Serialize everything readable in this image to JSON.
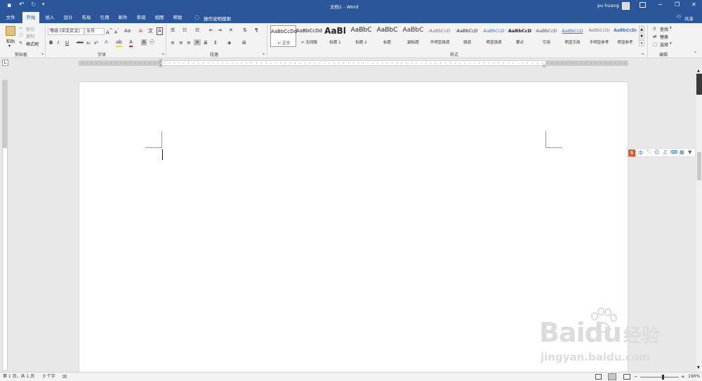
{
  "titlebar": {
    "title": "文档1 - Word",
    "user": "pu huang"
  },
  "tabs": [
    "文件",
    "开始",
    "插入",
    "设计",
    "布局",
    "引用",
    "邮件",
    "审阅",
    "视图",
    "帮助"
  ],
  "tell_me": "操作说明搜索",
  "share": "共享",
  "clipboard": {
    "paste": "粘贴",
    "cut": "剪切",
    "copy": "复制",
    "format_painter": "格式刷",
    "label": "剪贴板"
  },
  "font": {
    "name": "等线 (中文正文)",
    "size": "五号",
    "aa": "Aa",
    "label": "字体"
  },
  "paragraph": {
    "label": "段落"
  },
  "styles": {
    "label": "样式",
    "items": [
      {
        "preview": "AaBbCcDd",
        "name": "↵ 正文"
      },
      {
        "preview": "AaBbCcDd",
        "name": "↵ 无间隔"
      },
      {
        "preview": "AaBl",
        "name": "标题 1"
      },
      {
        "preview": "AaBbC",
        "name": "标题 2"
      },
      {
        "preview": "AaBbC",
        "name": "标题"
      },
      {
        "preview": "AaBbC",
        "name": "副标题"
      },
      {
        "preview": "AaBbCcD",
        "name": "不明显强调"
      },
      {
        "preview": "AaBbCcD",
        "name": "强调"
      },
      {
        "preview": "AaBbCcD",
        "name": "明显强调"
      },
      {
        "preview": "AaBbCcD",
        "name": "要点"
      },
      {
        "preview": "AaBbCcD",
        "name": "引用"
      },
      {
        "preview": "AaBbCcD",
        "name": "明显引用"
      },
      {
        "preview": "AaBbCcDı",
        "name": "不明显参考"
      },
      {
        "preview": "AaBbCcDı",
        "name": "明显参考"
      }
    ]
  },
  "editing": {
    "find": "查找",
    "replace": "替换",
    "select": "选择",
    "label": "编辑"
  },
  "status": {
    "page": "第 1 页，共 1 页",
    "words": "0 个字",
    "zoom": "190%"
  },
  "watermark": {
    "brand": "Baidu",
    "brand_cn": "经验",
    "url": "jingyan.baidu.com"
  },
  "ime": {
    "lang": "中"
  }
}
